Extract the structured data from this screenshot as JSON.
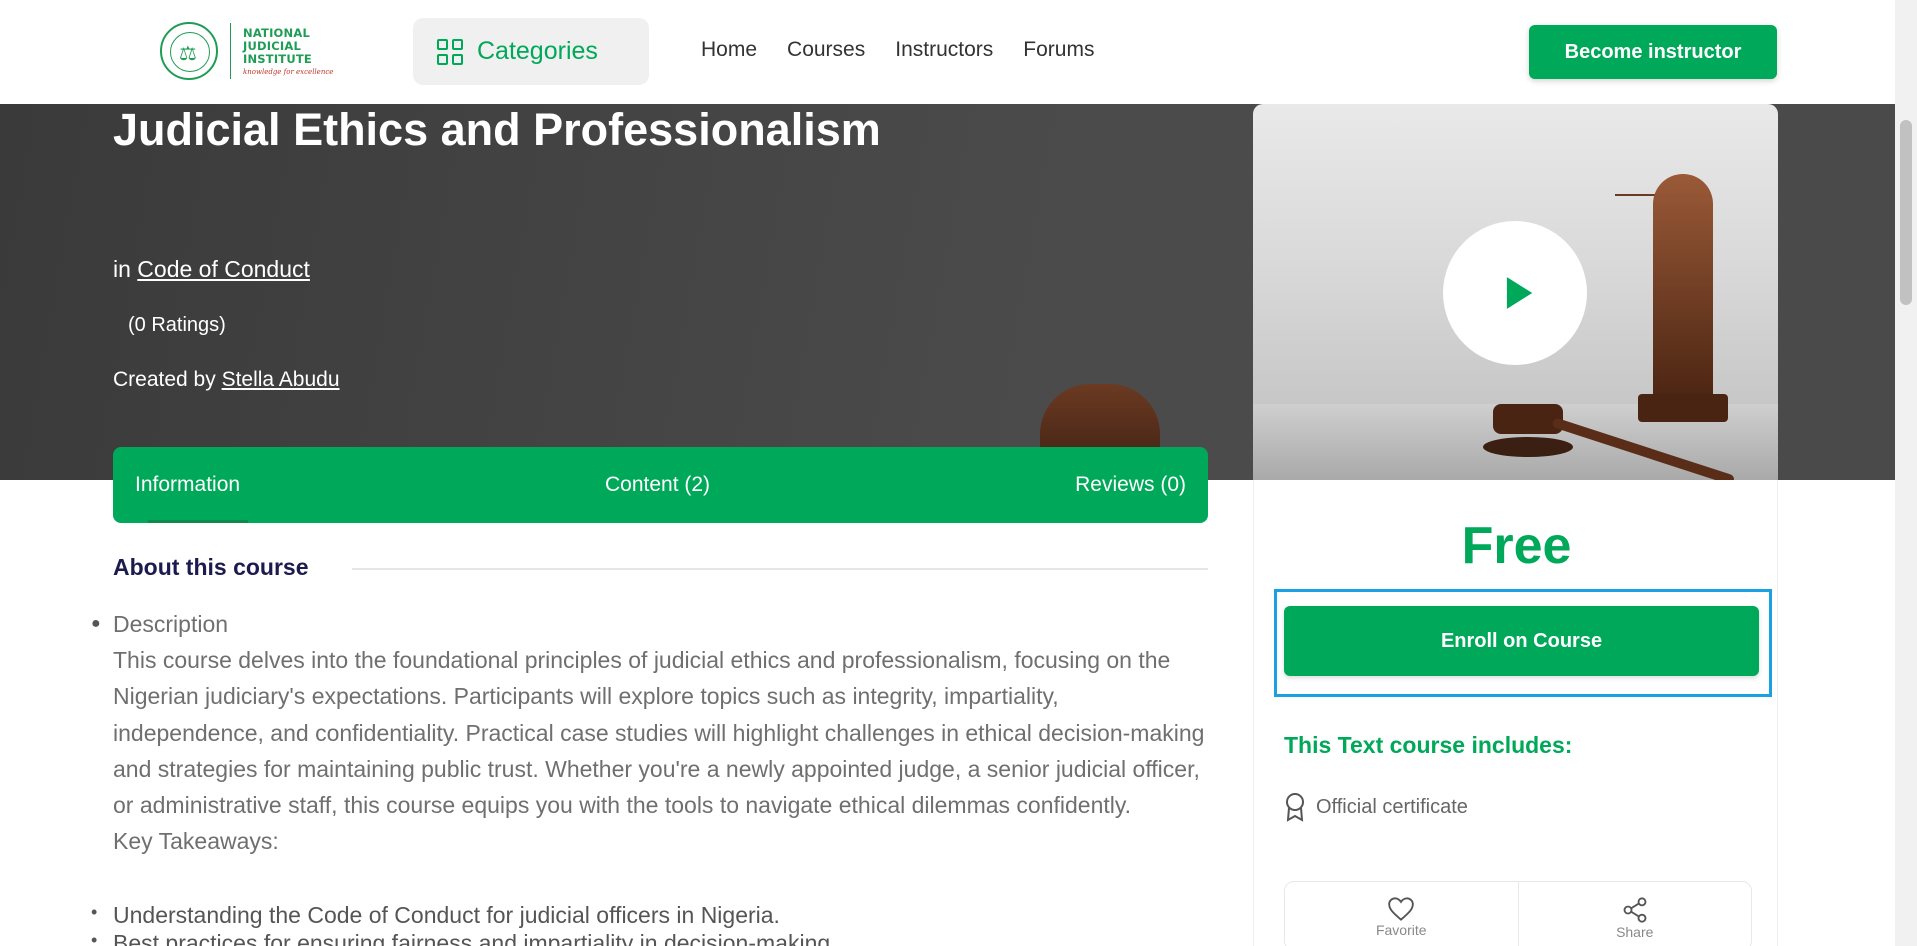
{
  "header": {
    "logo": {
      "lines": [
        "NATIONAL",
        "JUDICIAL",
        "INSTITUTE"
      ],
      "tagline": "knowledge for excellence"
    },
    "categories_label": "Categories",
    "nav": [
      "Home",
      "Courses",
      "Instructors",
      "Forums"
    ],
    "become_instructor": "Become instructor"
  },
  "hero": {
    "title": "Judicial Ethics and Professionalism",
    "in_prefix": "in",
    "category": "Code of Conduct",
    "ratings": "(0 Ratings)",
    "created_prefix": "Created by",
    "author": "Stella Abudu"
  },
  "tabs": [
    "Information",
    "Content (2)",
    "Reviews (0)"
  ],
  "about": {
    "heading": "About this course",
    "bullet_title": "Description",
    "description": "This course delves into the foundational principles of judicial ethics and professionalism, focusing on the Nigerian judiciary's expectations. Participants will explore topics such as integrity, impartiality, independence, and confidentiality. Practical case studies will highlight challenges in ethical decision-making and strategies for maintaining public trust. Whether you're a newly appointed judge, a senior judicial officer, or administrative staff, this course equips you with the tools to navigate ethical dilemmas confidently.",
    "key_takeaways_label": "Key Takeaways:",
    "takeaways": [
      "Understanding the Code of Conduct for judicial officers in Nigeria.",
      "Best practices for ensuring fairness and impartiality in decision-making."
    ]
  },
  "sidebar": {
    "price": "Free",
    "enroll": "Enroll on Course",
    "includes_title": "This Text course includes:",
    "includes": [
      "Official certificate"
    ],
    "actions": [
      "Favorite",
      "Share"
    ]
  },
  "colors": {
    "brand_green": "#00a859",
    "focus_outline": "#1ba1e2",
    "heading_navy": "#1b1b4f"
  }
}
